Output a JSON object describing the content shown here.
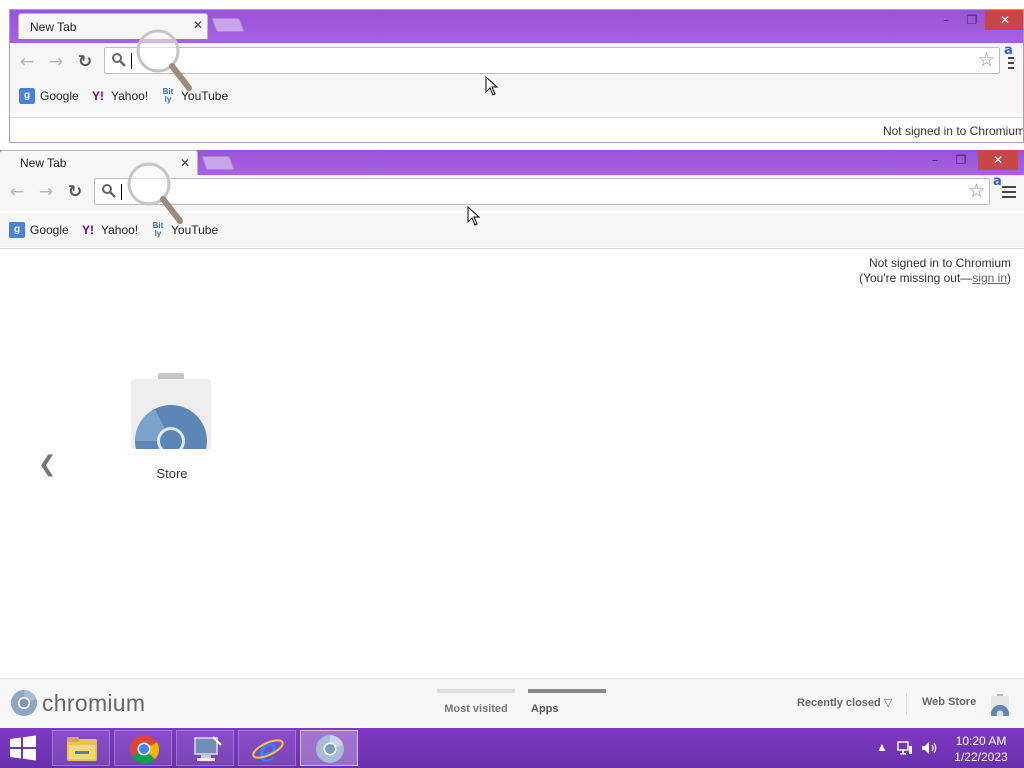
{
  "colors": {
    "frame_purple": "#9a53d8",
    "taskbar_purple": "#6a2fae",
    "close_red": "#c74646",
    "link_gray": "#666666"
  },
  "window_back": {
    "tab_title": "New Tab",
    "bookmarks": [
      {
        "label": "Google",
        "icon": "google-icon"
      },
      {
        "label": "Yahoo!",
        "icon": "yahoo-icon"
      },
      {
        "label": "YouTube",
        "icon": "bitly-icon"
      }
    ],
    "signin_text": "Not signed in to Chromium"
  },
  "window_front": {
    "tab_title": "New Tab",
    "omnibox_value": "",
    "bookmarks": [
      {
        "label": "Google",
        "icon": "google-icon"
      },
      {
        "label": "Yahoo!",
        "icon": "yahoo-icon"
      },
      {
        "label": "YouTube",
        "icon": "bitly-icon"
      }
    ],
    "signin_line1": "Not signed in to Chromium",
    "signin_line2_prefix": "(You're missing out—",
    "signin_link": "sign in",
    "signin_line2_suffix": ")",
    "apps": [
      {
        "label": "Store",
        "icon": "web-store-icon"
      }
    ],
    "footer": {
      "brand": "chromium",
      "tabs": [
        {
          "label": "Most visited",
          "selected": false
        },
        {
          "label": "Apps",
          "selected": true
        }
      ],
      "recently_closed": "Recently closed",
      "web_store": "Web Store"
    }
  },
  "taskbar": {
    "items": [
      {
        "name": "file-explorer",
        "icon": "folder-icon"
      },
      {
        "name": "chrome",
        "icon": "chrome-icon"
      },
      {
        "name": "remote-desktop",
        "icon": "computer-icon"
      },
      {
        "name": "internet-explorer",
        "icon": "ie-icon"
      },
      {
        "name": "chromium",
        "icon": "chromium-icon",
        "active": true
      }
    ],
    "time": "10:20 AM",
    "date": "1/22/2023"
  }
}
